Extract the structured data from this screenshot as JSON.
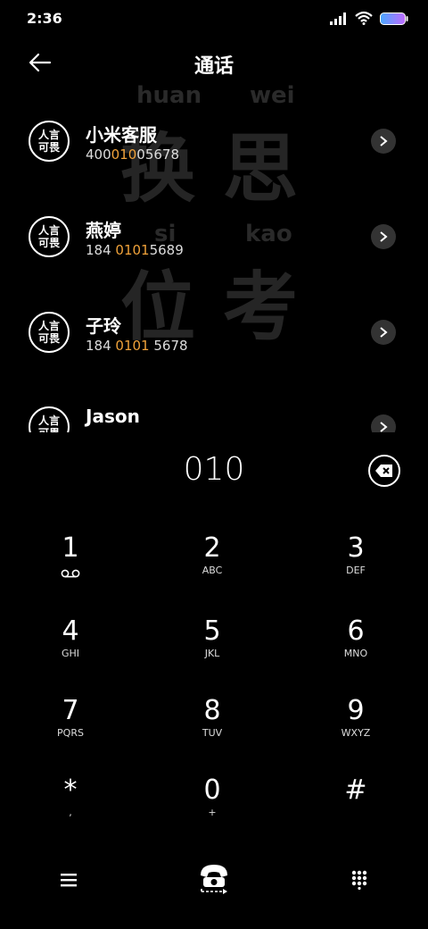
{
  "status": {
    "time": "2:36"
  },
  "header": {
    "title": "通话"
  },
  "watermark": {
    "pinyin": [
      "huan",
      "wei",
      "si",
      "kao"
    ],
    "chars": [
      "换",
      "思",
      "位",
      "考"
    ]
  },
  "avatar": {
    "line1": "人言",
    "line2": "可畏"
  },
  "contacts": [
    {
      "name": "小米客服",
      "num_pre": "400",
      "num_hl": "010",
      "num_post": "05678"
    },
    {
      "name": "燕婷",
      "num_pre": "184 ",
      "num_hl": "0101",
      "num_post": "5689"
    },
    {
      "name": "子玲",
      "num_pre": "184 ",
      "num_hl": "0101",
      "num_post": " 5678"
    },
    {
      "name": "Jason",
      "num_pre": "",
      "num_hl": "",
      "num_post": ""
    }
  ],
  "dialer": {
    "digits": "010"
  },
  "keys": [
    {
      "num": "1",
      "sub": ""
    },
    {
      "num": "2",
      "sub": "ABC"
    },
    {
      "num": "3",
      "sub": "DEF"
    },
    {
      "num": "4",
      "sub": "GHI"
    },
    {
      "num": "5",
      "sub": "JKL"
    },
    {
      "num": "6",
      "sub": "MNO"
    },
    {
      "num": "7",
      "sub": "PQRS"
    },
    {
      "num": "8",
      "sub": "TUV"
    },
    {
      "num": "9",
      "sub": "WXYZ"
    },
    {
      "num": "*",
      "sub": ","
    },
    {
      "num": "0",
      "sub": "+"
    },
    {
      "num": "#",
      "sub": ""
    }
  ],
  "colors": {
    "highlight": "#f0a23a",
    "background": "#000000",
    "watermark": "#252525"
  },
  "icons": {
    "status": [
      "signal-icon",
      "wifi-icon",
      "battery-icon"
    ],
    "bottom": [
      "menu-icon",
      "call-icon",
      "keypad-icon"
    ]
  }
}
